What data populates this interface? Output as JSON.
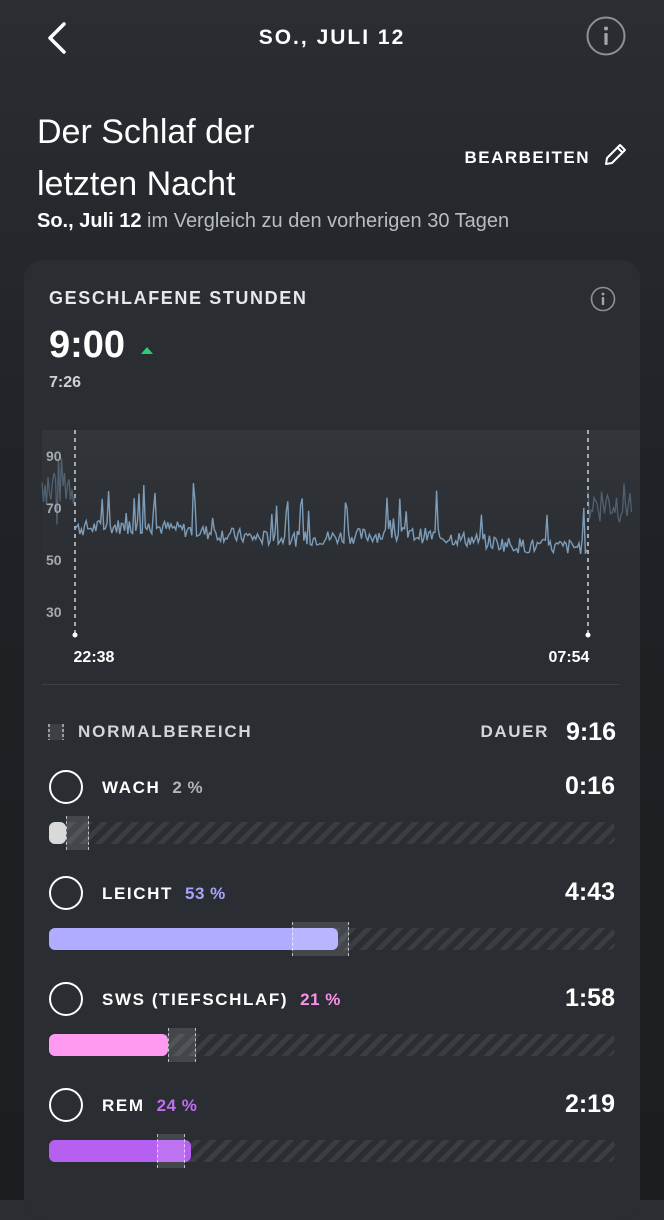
{
  "header": {
    "date_title": "SO., JULI 12",
    "back_icon": "chevron-left-icon",
    "info_icon": "info-icon"
  },
  "headline": {
    "title_line1": "Der Schlaf der",
    "title_line2": "letzten Nacht",
    "edit_label": "BEARBEITEN",
    "edit_icon": "pencil-icon",
    "subtitle_date": "So., Juli 12",
    "subtitle_rest": " im Vergleich zu den vorherigen 30 Tagen"
  },
  "card": {
    "title": "GESCHLAFENE STUNDEN",
    "value": "9:00",
    "trend": "up",
    "average": "7:26"
  },
  "chart_data": {
    "type": "line",
    "y_ticks": [
      "90",
      "70",
      "50",
      "30"
    ],
    "ylim": [
      20,
      100
    ],
    "start_label": "22:38",
    "end_label": "07:54",
    "line_color": "#7d9cb8"
  },
  "stages": {
    "legend_label": "NORMALBEREICH",
    "duration_label": "DAUER",
    "duration_total": "9:16",
    "items": [
      {
        "name": "WACH",
        "pct": "2 %",
        "time": "0:16",
        "fraction": 0.03,
        "range": [
          0.03,
          0.07
        ],
        "color": "#d9d9d9",
        "pct_color": "#b0b3b7"
      },
      {
        "name": "LEICHT",
        "pct": "53 %",
        "time": "4:43",
        "fraction": 0.51,
        "range": [
          0.43,
          0.53
        ],
        "color": "#b0acff",
        "pct_color": "#a7a3ff"
      },
      {
        "name": "SWS (TIEFSCHLAF)",
        "pct": "21 %",
        "time": "1:58",
        "fraction": 0.21,
        "range": [
          0.21,
          0.26
        ],
        "color": "#ff9af0",
        "pct_color": "#ff8fe9"
      },
      {
        "name": "REM",
        "pct": "24 %",
        "time": "2:19",
        "fraction": 0.25,
        "range": [
          0.19,
          0.24
        ],
        "color": "#b660f2",
        "pct_color": "#c06cf5"
      }
    ]
  }
}
